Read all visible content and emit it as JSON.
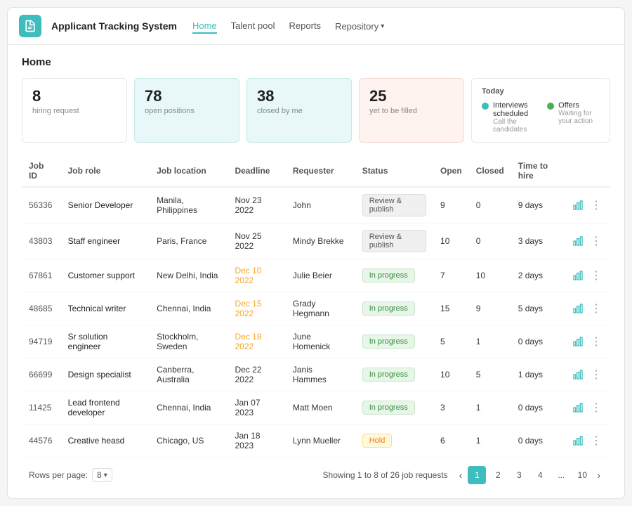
{
  "app": {
    "title": "Applicant Tracking System",
    "icon_label": "ATS"
  },
  "nav": {
    "items": [
      {
        "label": "Home",
        "active": true
      },
      {
        "label": "Talent pool",
        "active": false
      },
      {
        "label": "Reports",
        "active": false
      },
      {
        "label": "Repository",
        "active": false,
        "has_dropdown": true
      }
    ]
  },
  "page": {
    "title": "Home"
  },
  "stats": [
    {
      "number": "8",
      "label": "hiring request",
      "style": "normal"
    },
    {
      "number": "78",
      "label": "open positions",
      "style": "blue"
    },
    {
      "number": "38",
      "label": "closed by me",
      "style": "blue"
    },
    {
      "number": "25",
      "label": "yet to be filled",
      "style": "peach"
    }
  ],
  "today": {
    "title": "Today",
    "items": [
      {
        "label": "Interviews scheduled",
        "sub": "Call the candidates",
        "color": "blue"
      },
      {
        "label": "Offers",
        "sub": "Waiting for your action",
        "color": "green"
      }
    ]
  },
  "table": {
    "columns": [
      "Job ID",
      "Job role",
      "Job location",
      "Deadline",
      "Requester",
      "Status",
      "Open",
      "Closed",
      "Time to hire",
      ""
    ],
    "rows": [
      {
        "id": "56336",
        "role": "Senior Developer",
        "location": "Manila, Philippines",
        "deadline": "Nov 23 2022",
        "deadline_orange": false,
        "requester": "John",
        "status": "Review & publish",
        "status_type": "review",
        "open": 9,
        "closed": 0,
        "time": "9 days"
      },
      {
        "id": "43803",
        "role": "Staff engineer",
        "location": "Paris, France",
        "deadline": "Nov 25 2022",
        "deadline_orange": false,
        "requester": "Mindy Brekke",
        "status": "Review & publish",
        "status_type": "review",
        "open": 10,
        "closed": 0,
        "time": "3 days"
      },
      {
        "id": "67861",
        "role": "Customer support",
        "location": "New Delhi, India",
        "deadline": "Dec 10 2022",
        "deadline_orange": true,
        "requester": "Julie Beier",
        "status": "In progress",
        "status_type": "progress",
        "open": 7,
        "closed": 10,
        "time": "2 days"
      },
      {
        "id": "48685",
        "role": "Technical writer",
        "location": "Chennai, India",
        "deadline": "Dec 15 2022",
        "deadline_orange": true,
        "requester": "Grady Hegmann",
        "status": "In progress",
        "status_type": "progress",
        "open": 15,
        "closed": 9,
        "time": "5 days"
      },
      {
        "id": "94719",
        "role": "Sr solution engineer",
        "location": "Stockholm, Sweden",
        "deadline": "Dec 18 2022",
        "deadline_orange": true,
        "requester": "June Homenick",
        "status": "In progress",
        "status_type": "progress",
        "open": 5,
        "closed": 1,
        "time": "0 days"
      },
      {
        "id": "66699",
        "role": "Design specialist",
        "location": "Canberra, Australia",
        "deadline": "Dec 22 2022",
        "deadline_orange": false,
        "requester": "Janis Hammes",
        "status": "In progress",
        "status_type": "progress",
        "open": 10,
        "closed": 5,
        "time": "1 days"
      },
      {
        "id": "11425",
        "role": "Lead frontend developer",
        "location": "Chennai, India",
        "deadline": "Jan 07 2023",
        "deadline_orange": false,
        "requester": "Matt Moen",
        "status": "In progress",
        "status_type": "progress",
        "open": 3,
        "closed": 1,
        "time": "0 days"
      },
      {
        "id": "44576",
        "role": "Creative heasd",
        "location": "Chicago, US",
        "deadline": "Jan 18 2023",
        "deadline_orange": false,
        "requester": "Lynn Mueller",
        "status": "Hold",
        "status_type": "hold",
        "open": 6,
        "closed": 1,
        "time": "0 days"
      }
    ]
  },
  "pagination": {
    "rows_per_page_label": "Rows per page:",
    "rows_per_page_value": "8",
    "showing_text": "Showing 1 to 8 of 26 job requests",
    "pages": [
      "1",
      "2",
      "3",
      "4",
      "...",
      "10"
    ],
    "active_page": "1"
  }
}
